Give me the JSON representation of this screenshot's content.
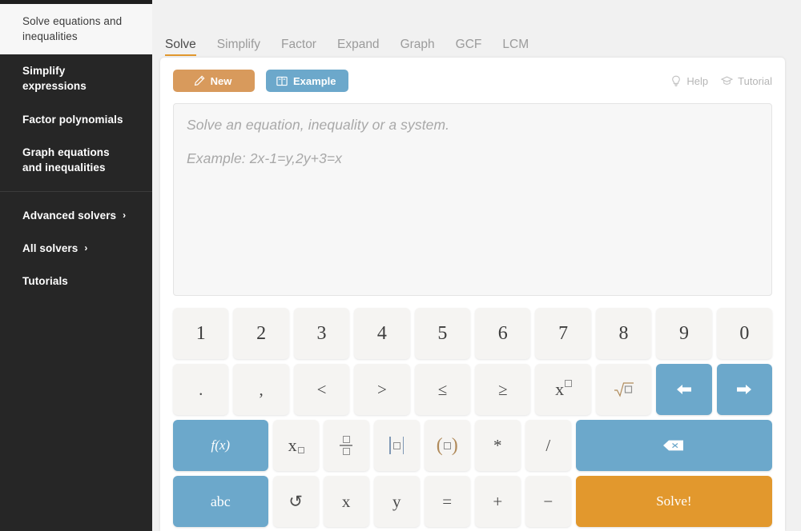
{
  "sidebar": {
    "items": [
      {
        "label": "Solve equations and inequalities",
        "active": true,
        "chevron": ""
      },
      {
        "label": "Simplify expressions",
        "active": false,
        "chevron": ""
      },
      {
        "label": "Factor polynomials",
        "active": false,
        "chevron": ""
      },
      {
        "label": "Graph equations and inequalities",
        "active": false,
        "chevron": ""
      },
      {
        "label": "Advanced solvers",
        "active": false,
        "chevron": "›"
      },
      {
        "label": "All solvers",
        "active": false,
        "chevron": "›"
      },
      {
        "label": "Tutorials",
        "active": false,
        "chevron": ""
      }
    ]
  },
  "tabs": [
    {
      "label": "Solve",
      "active": true
    },
    {
      "label": "Simplify",
      "active": false
    },
    {
      "label": "Factor",
      "active": false
    },
    {
      "label": "Expand",
      "active": false
    },
    {
      "label": "Graph",
      "active": false
    },
    {
      "label": "GCF",
      "active": false
    },
    {
      "label": "LCM",
      "active": false
    }
  ],
  "toolbar": {
    "new_label": "New",
    "new_icon": "pencil-icon",
    "example_label": "Example",
    "example_icon": "book-icon",
    "help_label": "Help",
    "help_icon": "lightbulb-icon",
    "tutorial_label": "Tutorial",
    "tutorial_icon": "graduation-cap-icon"
  },
  "input": {
    "placeholder_line1": "Solve an equation, inequality or a system.",
    "placeholder_line2": "Example: 2x-1=y,2y+3=x",
    "value": ""
  },
  "keypad": {
    "rows": [
      [
        {
          "name": "key-1",
          "label": "1",
          "kind": "num"
        },
        {
          "name": "key-2",
          "label": "2",
          "kind": "num"
        },
        {
          "name": "key-3",
          "label": "3",
          "kind": "num"
        },
        {
          "name": "key-4",
          "label": "4",
          "kind": "num"
        },
        {
          "name": "key-5",
          "label": "5",
          "kind": "num"
        },
        {
          "name": "key-6",
          "label": "6",
          "kind": "num"
        },
        {
          "name": "key-7",
          "label": "7",
          "kind": "num"
        },
        {
          "name": "key-8",
          "label": "8",
          "kind": "num"
        },
        {
          "name": "key-9",
          "label": "9",
          "kind": "num"
        },
        {
          "name": "key-0",
          "label": "0",
          "kind": "num"
        }
      ],
      [
        {
          "name": "key-period",
          "label": ".",
          "kind": "sym"
        },
        {
          "name": "key-comma",
          "label": ",",
          "kind": "sym"
        },
        {
          "name": "key-less-than",
          "label": "<",
          "kind": "sym"
        },
        {
          "name": "key-greater-than",
          "label": ">",
          "kind": "sym"
        },
        {
          "name": "key-less-or-equal",
          "label": "≤",
          "kind": "sym"
        },
        {
          "name": "key-greater-or-equal",
          "label": "≥",
          "kind": "sym"
        },
        {
          "name": "key-power",
          "label": "x□",
          "kind": "glyph-power"
        },
        {
          "name": "key-square-root",
          "label": "√□",
          "kind": "glyph-sqrt"
        },
        {
          "name": "key-arrow-left",
          "label": "←",
          "kind": "blue-icon"
        },
        {
          "name": "key-arrow-right",
          "label": "→",
          "kind": "blue-icon"
        }
      ],
      [
        {
          "name": "key-function",
          "label": "f(x)",
          "kind": "blue-wide"
        },
        {
          "name": "key-subscript",
          "label": "x□",
          "kind": "glyph-sub"
        },
        {
          "name": "key-fraction",
          "label": "□/□",
          "kind": "glyph-frac"
        },
        {
          "name": "key-absolute-value",
          "label": "|□|",
          "kind": "glyph-abs"
        },
        {
          "name": "key-parentheses",
          "label": "(□)",
          "kind": "glyph-paren"
        },
        {
          "name": "key-multiply",
          "label": "*",
          "kind": "sym"
        },
        {
          "name": "key-divide",
          "label": "/",
          "kind": "sym"
        },
        {
          "name": "key-backspace",
          "label": "⌫",
          "kind": "blue-wide-icon"
        }
      ],
      [
        {
          "name": "key-abc",
          "label": "abc",
          "kind": "blue-wide-text"
        },
        {
          "name": "key-undo",
          "label": "↺",
          "kind": "sym"
        },
        {
          "name": "key-x",
          "label": "x",
          "kind": "sym"
        },
        {
          "name": "key-y",
          "label": "y",
          "kind": "sym"
        },
        {
          "name": "key-equals",
          "label": "=",
          "kind": "sym"
        },
        {
          "name": "key-plus",
          "label": "+",
          "kind": "sym"
        },
        {
          "name": "key-minus",
          "label": "−",
          "kind": "sym"
        },
        {
          "name": "key-solve",
          "label": "Solve!",
          "kind": "orange-wide"
        }
      ]
    ]
  },
  "colors": {
    "sidebar_bg": "#262626",
    "sidebar_active_bg": "#f7f7f7",
    "accent_orange": "#e2982d",
    "button_orange": "#d89a5c",
    "button_blue": "#6ca8cb",
    "page_bg": "#f1f1f1",
    "card_bg": "#ffffff",
    "key_bg": "#f5f4f2"
  }
}
